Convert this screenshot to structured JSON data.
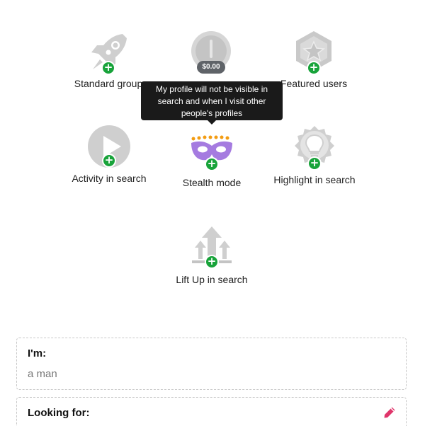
{
  "features": {
    "standard_group": {
      "label": "Standard group",
      "icon": "rocket-icon"
    },
    "price": {
      "label": "",
      "price_tag": "$0.00",
      "icon": "coin-icon"
    },
    "featured_users": {
      "label": "Featured users",
      "icon": "star-badge-icon"
    },
    "activity_in_search": {
      "label": "Activity in search",
      "icon": "play-icon"
    },
    "stealth_mode": {
      "label": "Stealth mode",
      "icon": "mask-icon"
    },
    "highlight_in_search": {
      "label": "Highlight in search",
      "icon": "lightbulb-icon"
    },
    "lift_up_in_search": {
      "label": "Lift Up in search",
      "icon": "arrows-up-icon"
    }
  },
  "tooltip": {
    "line1": "My profile will not be visible in",
    "line2": "search and when I visit other",
    "line3": "people's profiles"
  },
  "profile": {
    "im": {
      "title": "I'm:",
      "value": "a man"
    },
    "looking_for": {
      "title": "Looking for:",
      "value": ""
    }
  },
  "colors": {
    "plus_badge": "#18a33a",
    "icon_gray": "#cfcfcf",
    "mask_purple": "#a57be0",
    "mask_dots": "#f39c12",
    "edit_pink": "#e0356b",
    "tooltip_bg": "#1a1a1a"
  }
}
